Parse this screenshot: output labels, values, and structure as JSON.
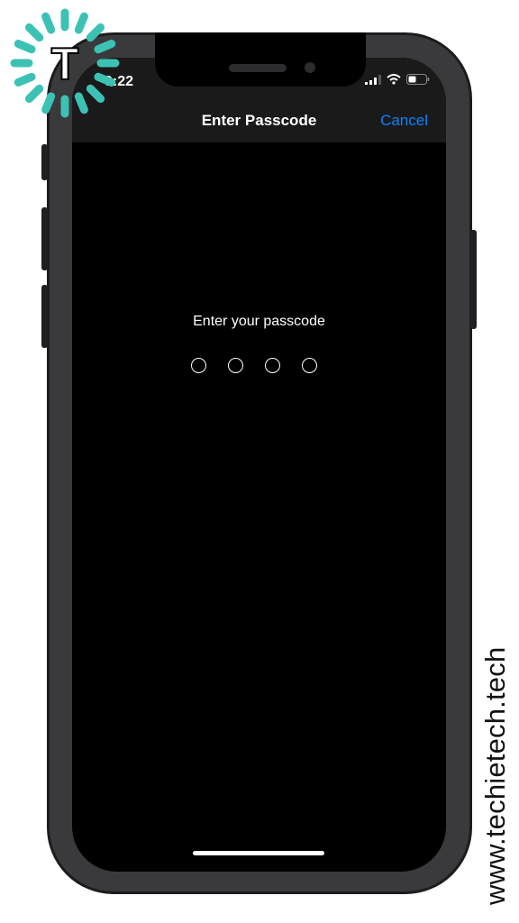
{
  "status_bar": {
    "time": "9:22",
    "icons": [
      "signal-icon",
      "wifi-icon",
      "battery-icon"
    ]
  },
  "nav": {
    "title": "Enter Passcode",
    "cancel_label": "Cancel"
  },
  "passcode": {
    "prompt": "Enter your passcode",
    "digits_total": 4,
    "digits_entered": 0
  },
  "branding": {
    "logo_letter": "T",
    "watermark": "www.techietech.tech"
  },
  "colors": {
    "accent": "#0a84ff",
    "logo": "#3cc2b4",
    "screen_bg": "#000000",
    "nav_bg": "#1a1a1a"
  }
}
